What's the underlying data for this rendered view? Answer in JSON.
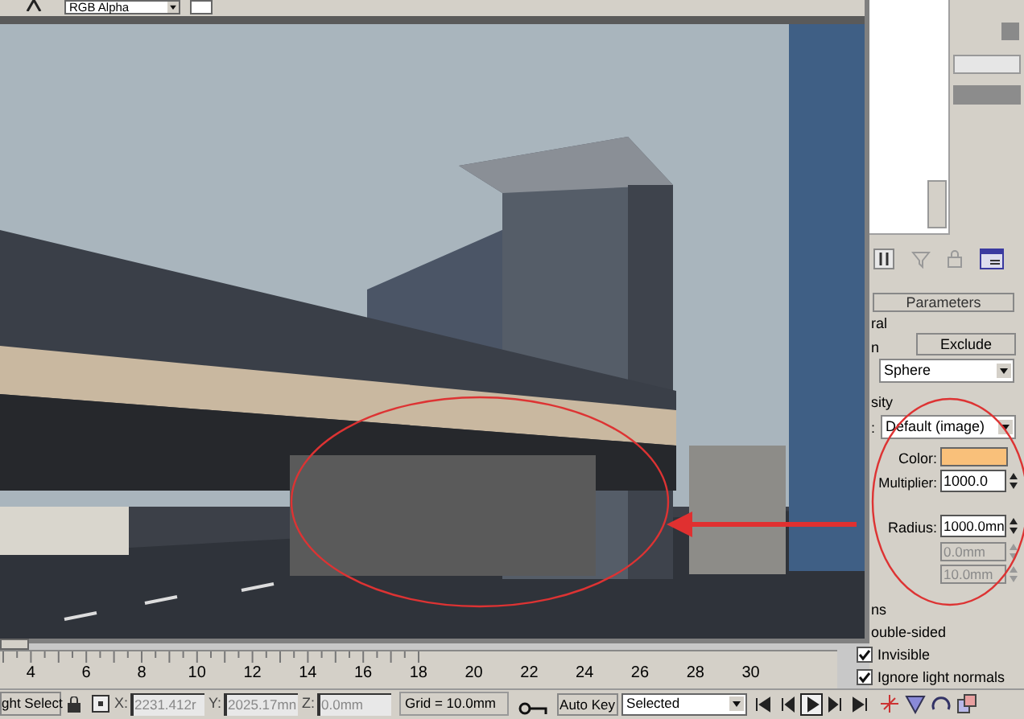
{
  "render_window": {
    "channel_dropdown": "RGB Alpha"
  },
  "command_panel": {
    "rollout_title": "Parameters",
    "general": {
      "label": "ral",
      "include_label": "n",
      "exclude_button": "Exclude",
      "shape_dropdown": "Sphere"
    },
    "intensity": {
      "label": "sity",
      "type_label": ":",
      "type_dropdown": "Default (image)",
      "color_label": "Color:",
      "color": "#f9c07a",
      "multiplier_label": "Multiplier:",
      "multiplier_value": "1000.0"
    },
    "shape": {
      "radius_label": "Radius:",
      "radius_value": "1000.0mn",
      "fields": [
        {
          "value": "0.0mm",
          "disabled": true
        },
        {
          "value": "10.0mm",
          "disabled": true
        }
      ]
    },
    "options": {
      "label": "ns",
      "checkboxes": [
        {
          "label": "ouble-sided"
        },
        {
          "label": "Invisible",
          "checked": true
        },
        {
          "label": "Ignore light normals",
          "checked": true
        }
      ]
    }
  },
  "timeline": {
    "ticks": [
      "4",
      "6",
      "8",
      "10",
      "12",
      "14",
      "16",
      "18",
      "20",
      "22",
      "24",
      "26",
      "28",
      "30"
    ]
  },
  "status_bar": {
    "selection_button": "ght Select",
    "x_label": "X:",
    "x_value": "2231.412r",
    "y_label": "Y:",
    "y_value": "2025.17mn",
    "z_label": "Z:",
    "z_value": "0.0mm",
    "grid": "Grid = 10.0mm",
    "auto_key": "Auto Key",
    "key_filter": "Selected",
    "playback": [
      {
        "kind": "start",
        "selected": false
      },
      {
        "kind": "prev",
        "selected": false
      },
      {
        "kind": "play",
        "selected": true
      },
      {
        "kind": "next",
        "selected": false
      },
      {
        "kind": "end",
        "selected": false
      }
    ]
  }
}
